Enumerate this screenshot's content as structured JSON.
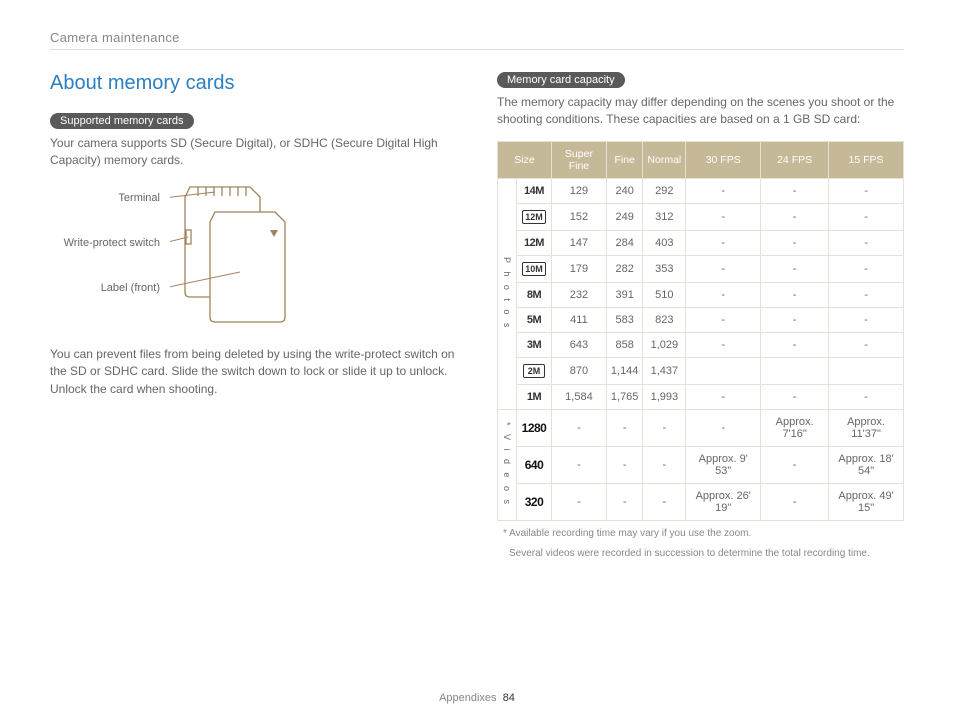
{
  "header": {
    "section": "Camera maintenance"
  },
  "left": {
    "title": "About memory cards",
    "pill1": "Supported memory cards",
    "p1": "Your camera supports SD (Secure Digital), or SDHC (Secure Digital High Capacity) memory cards.",
    "diagram": {
      "terminal": "Terminal",
      "write_protect": "Write-protect switch",
      "label_front": "Label (front)"
    },
    "p2": "You can prevent files from being deleted by using the write-protect switch on the SD or SDHC card. Slide the switch down to lock or slide it up to unlock. Unlock the card when shooting."
  },
  "right": {
    "pill2": "Memory card capacity",
    "intro": "The memory capacity may differ depending on the scenes you shoot or the shooting conditions. These capacities are based on a 1 GB SD card:",
    "headers": [
      "Size",
      "Super Fine",
      "Fine",
      "Normal",
      "30 FPS",
      "24 FPS",
      "15 FPS"
    ],
    "group_photos": "Photos",
    "group_videos": "* Videos",
    "photo_rows": [
      {
        "size": "14M",
        "box": false,
        "cells": [
          "129",
          "240",
          "292",
          "-",
          "-",
          "-"
        ]
      },
      {
        "size": "12M",
        "box": true,
        "cells": [
          "152",
          "249",
          "312",
          "-",
          "-",
          "-"
        ]
      },
      {
        "size": "12M",
        "box": false,
        "cells": [
          "147",
          "284",
          "403",
          "-",
          "-",
          "-"
        ]
      },
      {
        "size": "10M",
        "box": true,
        "cells": [
          "179",
          "282",
          "353",
          "-",
          "-",
          "-"
        ]
      },
      {
        "size": "8M",
        "box": false,
        "cells": [
          "232",
          "391",
          "510",
          "-",
          "-",
          "-"
        ]
      },
      {
        "size": "5M",
        "box": false,
        "cells": [
          "411",
          "583",
          "823",
          "-",
          "-",
          "-"
        ]
      },
      {
        "size": "3M",
        "box": false,
        "cells": [
          "643",
          "858",
          "1,029",
          "-",
          "-",
          "-"
        ]
      },
      {
        "size": "2M",
        "box": true,
        "cells": [
          "870",
          "1,144",
          "1,437",
          "",
          "",
          ""
        ]
      },
      {
        "size": "1M",
        "box": false,
        "cells": [
          "1,584",
          "1,765",
          "1,993",
          "-",
          "-",
          "-"
        ]
      }
    ],
    "video_rows": [
      {
        "size": "1280",
        "cells": [
          "-",
          "-",
          "-",
          "-",
          "Approx. 7'16\"",
          "Approx. 11'37\""
        ]
      },
      {
        "size": "640",
        "cells": [
          "-",
          "-",
          "-",
          "Approx. 9' 53\"",
          "-",
          "Approx. 18' 54\""
        ]
      },
      {
        "size": "320",
        "cells": [
          "-",
          "-",
          "-",
          "Approx. 26' 19\"",
          "-",
          "Approx. 49' 15\""
        ]
      }
    ],
    "footnote1": "* Available recording time may vary if you use the zoom.",
    "footnote2": "Several videos were recorded in succession to determine the total recording time."
  },
  "footer": {
    "label": "Appendixes",
    "page": "84"
  }
}
